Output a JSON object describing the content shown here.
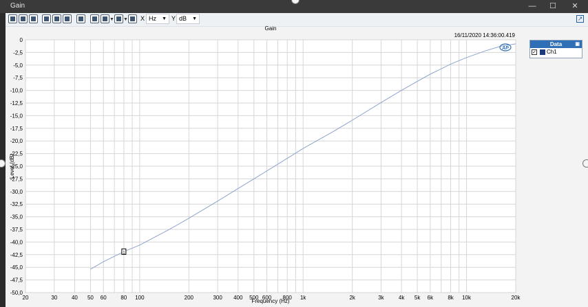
{
  "window": {
    "title": "Gain"
  },
  "toolbar": {
    "x_label": "X",
    "x_unit": "Hz",
    "y_label": "Y",
    "y_unit": "dB"
  },
  "colors": {
    "trace": "#8ea3cc",
    "grid": "#d6d6d6",
    "legend_header": "#2f6fb5",
    "swatch": "#1c3b7a"
  },
  "chart_data": {
    "type": "line",
    "title": "Gain",
    "timestamp": "16/11/2020 14:36:00.419",
    "xlabel": "Frequency (Hz)",
    "ylabel": "Level (dB)",
    "xscale": "log",
    "xlim": [
      20,
      20000
    ],
    "ylim": [
      -50,
      0
    ],
    "x_ticks": [
      20,
      30,
      40,
      50,
      60,
      80,
      100,
      200,
      300,
      400,
      500,
      600,
      800,
      1000,
      2000,
      3000,
      4000,
      5000,
      6000,
      8000,
      10000,
      20000
    ],
    "x_tick_labels": [
      "20",
      "30",
      "40",
      "50",
      "60",
      "80",
      "100",
      "200",
      "300",
      "400",
      "500",
      "600",
      "800",
      "1k",
      "2k",
      "3k",
      "4k",
      "5k",
      "6k",
      "8k",
      "10k",
      "20k"
    ],
    "y_tick_labels": [
      "0",
      "-2,5",
      "-5,0",
      "-7,5",
      "-10,0",
      "-12,5",
      "-15,0",
      "-17,5",
      "-20,0",
      "-22,5",
      "-25,0",
      "-27,5",
      "-30,0",
      "-32,5",
      "-35,0",
      "-37,5",
      "-40,0",
      "-42,5",
      "-45,0",
      "-47,5",
      "-50,0"
    ],
    "grid": true,
    "legend": {
      "title": "Data",
      "position": "right",
      "entries": [
        "Ch1"
      ]
    },
    "series": [
      {
        "name": "Ch1",
        "x": [
          50,
          60,
          80,
          100,
          150,
          200,
          300,
          400,
          500,
          700,
          1000,
          1500,
          2000,
          3000,
          4000,
          5000,
          6000,
          8000,
          10000,
          13000,
          16000,
          20000
        ],
        "y": [
          -45.4,
          -43.9,
          -41.9,
          -40.6,
          -37.6,
          -35.3,
          -31.9,
          -29.4,
          -27.5,
          -24.6,
          -21.5,
          -18.3,
          -15.9,
          -12.4,
          -10.0,
          -8.2,
          -6.8,
          -4.8,
          -3.5,
          -2.2,
          -1.3,
          -0.8
        ]
      }
    ],
    "marker": {
      "label": "1",
      "x": 80,
      "y": -41.9
    }
  }
}
